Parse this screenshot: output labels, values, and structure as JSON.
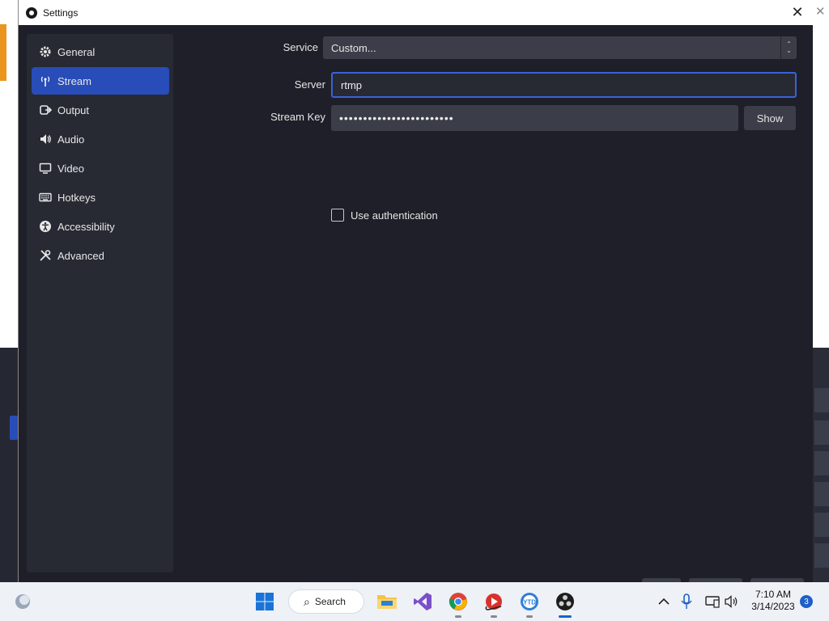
{
  "window": {
    "title": "Settings"
  },
  "sidebar": {
    "items": [
      {
        "label": "General",
        "icon": "gear-icon"
      },
      {
        "label": "Stream",
        "icon": "antenna-icon",
        "active": true
      },
      {
        "label": "Output",
        "icon": "output-icon"
      },
      {
        "label": "Audio",
        "icon": "speaker-icon"
      },
      {
        "label": "Video",
        "icon": "monitor-icon"
      },
      {
        "label": "Hotkeys",
        "icon": "keyboard-icon"
      },
      {
        "label": "Accessibility",
        "icon": "accessibility-icon"
      },
      {
        "label": "Advanced",
        "icon": "tools-icon"
      }
    ]
  },
  "stream": {
    "service_label": "Service",
    "service_value": "Custom...",
    "server_label": "Server",
    "server_value": "rtmp",
    "key_label": "Stream Key",
    "key_value": "••••••••••••••••••••••••",
    "show_button": "Show",
    "use_auth_label": "Use authentication",
    "use_auth_checked": false
  },
  "taskbar": {
    "search_label": "Search",
    "clock_time": "7:10 AM",
    "clock_date": "3/14/2023",
    "notification_count": "3",
    "accent": "#1464c8"
  },
  "colors": {
    "dialog_bg": "#1e1f28",
    "sidebar_bg": "#272a33",
    "active_item": "#284cb8",
    "focus_border": "#3a62d8"
  }
}
